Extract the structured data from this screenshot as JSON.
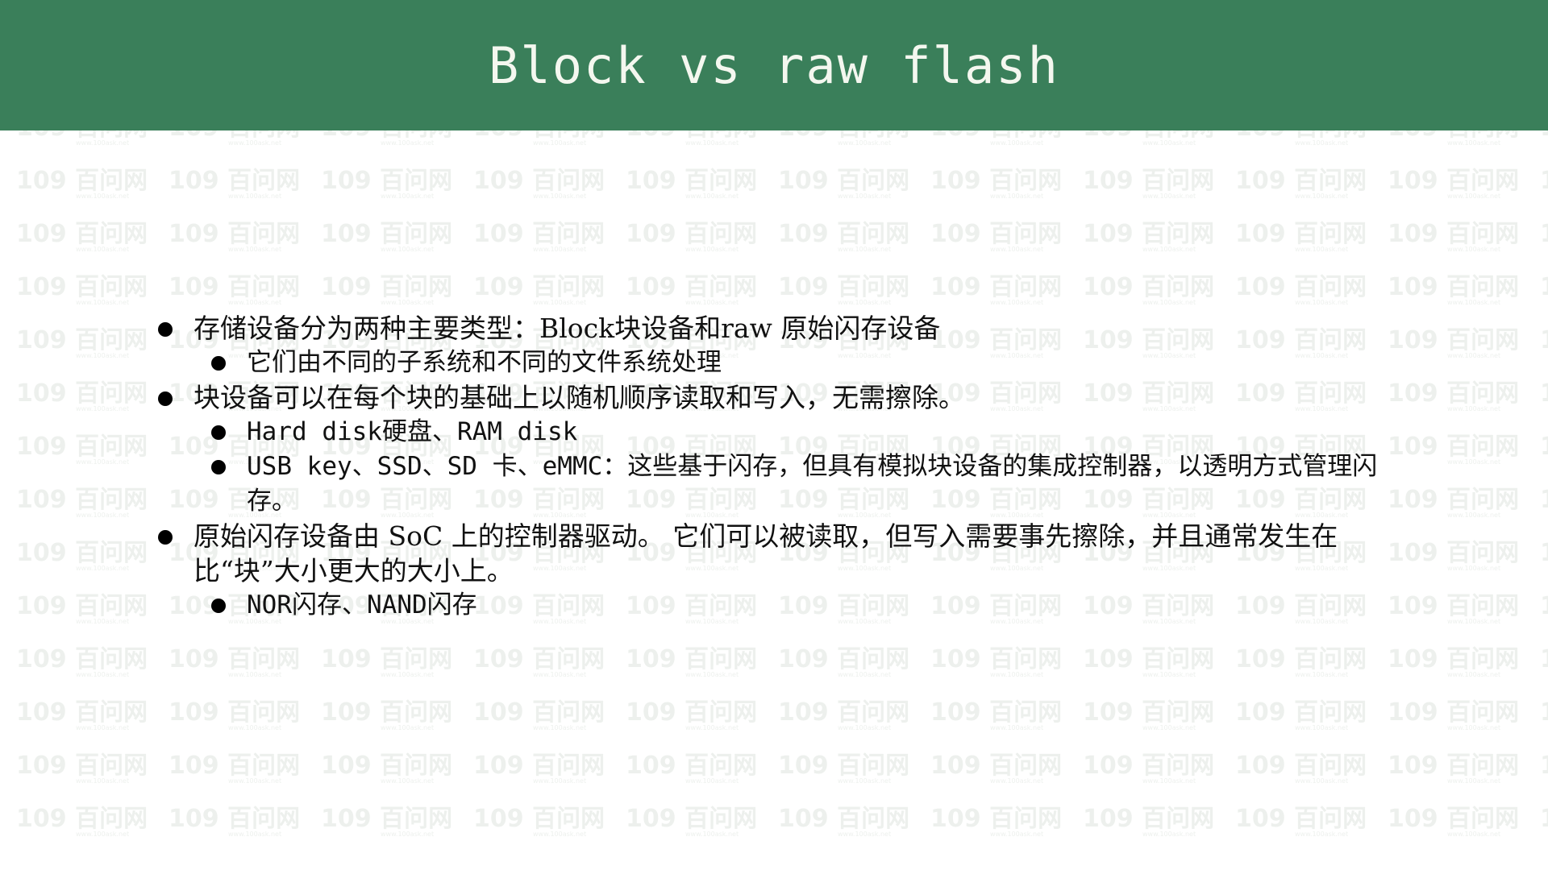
{
  "slide": {
    "title": "Block vs raw flash",
    "watermark": {
      "mark": "109",
      "name": "百问网",
      "url": "www.100ask.net",
      "color": "#dfe5df"
    },
    "accent_color": "#3a7f5a",
    "bullets": [
      {
        "level": 1,
        "text": "存储设备分为两种主要类型：Block块设备和raw 原始闪存设备"
      },
      {
        "level": 2,
        "text": "它们由不同的子系统和不同的文件系统处理"
      },
      {
        "level": 1,
        "text": "块设备可以在每个块的基础上以随机顺序读取和写入，无需擦除。"
      },
      {
        "level": 2,
        "text": "Hard disk硬盘、RAM disk"
      },
      {
        "level": 2,
        "text": "USB key、SSD、SD 卡、eMMC：这些基于闪存，但具有模拟块设备的集成控制器，以透明方式管理闪存。"
      },
      {
        "level": 1,
        "text": "原始闪存设备由 SoC 上的控制器驱动。 它们可以被读取，但写入需要事先擦除，并且通常发生在比“块”大小更大的大小上。"
      },
      {
        "level": 2,
        "text": "NOR闪存、NAND闪存"
      }
    ]
  }
}
